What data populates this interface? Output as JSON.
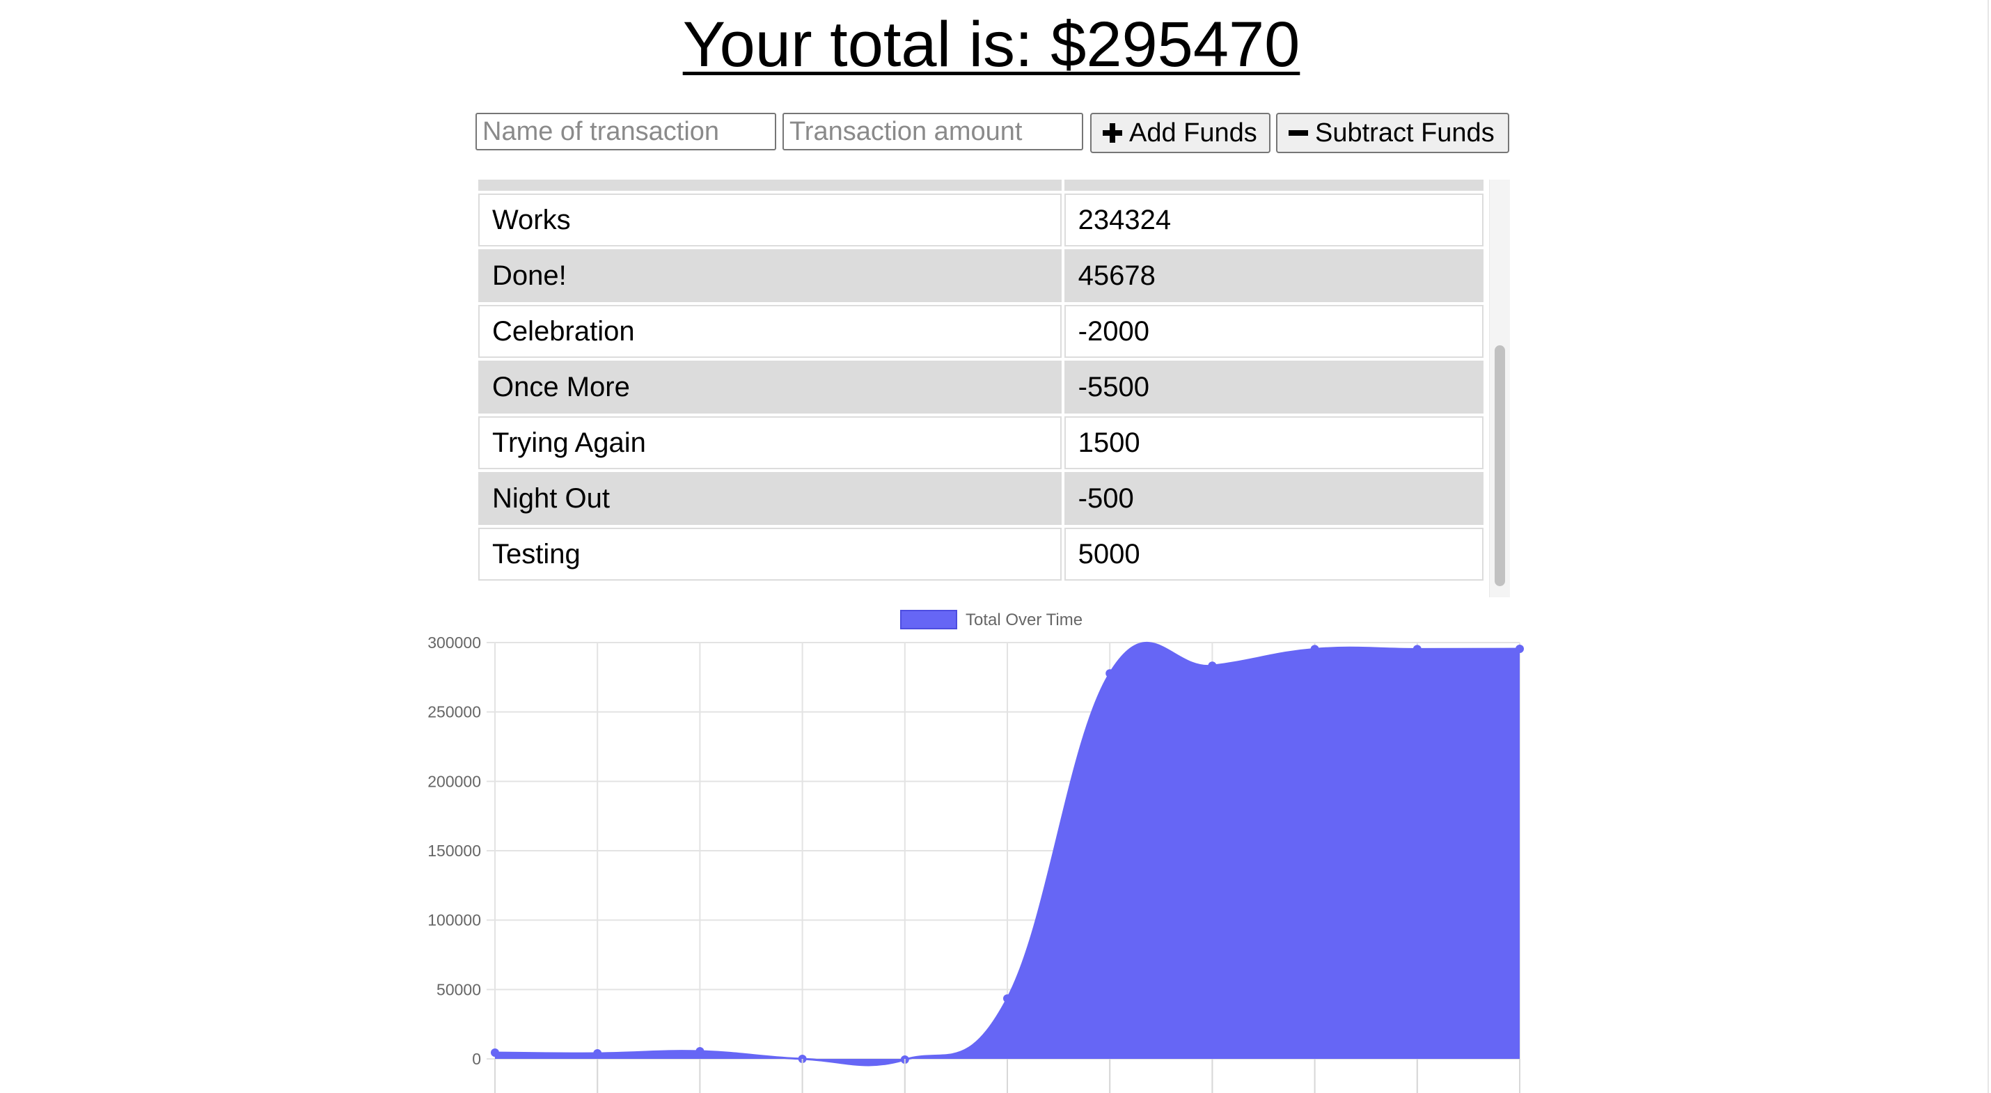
{
  "header": {
    "total_label": "Your total is: $295470"
  },
  "form": {
    "name_placeholder": "Name of transaction",
    "amount_placeholder": "Transaction amount",
    "add_button_label": "Add Funds",
    "subtract_button_label": "Subtract Funds",
    "add_icon": "plus-icon",
    "subtract_icon": "minus-icon"
  },
  "transactions": [
    {
      "name": "",
      "value": ""
    },
    {
      "name": "Works",
      "value": "234324"
    },
    {
      "name": "Done!",
      "value": "45678"
    },
    {
      "name": "Celebration",
      "value": "-2000"
    },
    {
      "name": "Once More",
      "value": "-5500"
    },
    {
      "name": "Trying Again",
      "value": "1500"
    },
    {
      "name": "Night Out",
      "value": "-500"
    },
    {
      "name": "Testing",
      "value": "5000"
    }
  ],
  "chart_data": {
    "type": "area",
    "title": "",
    "xlabel": "",
    "ylabel": "",
    "legend": {
      "position": "top",
      "entries": [
        "Total Over Time"
      ]
    },
    "grid": true,
    "ylim": [
      0,
      300000
    ],
    "yticks": [
      0,
      50000,
      100000,
      150000,
      200000,
      250000,
      300000
    ],
    "series": [
      {
        "name": "Total Over Time",
        "color": "#6666f5",
        "values": [
          4500,
          4000,
          5500,
          0,
          -500,
          43500,
          277800,
          283300,
          295300,
          295300,
          295470
        ]
      }
    ]
  }
}
